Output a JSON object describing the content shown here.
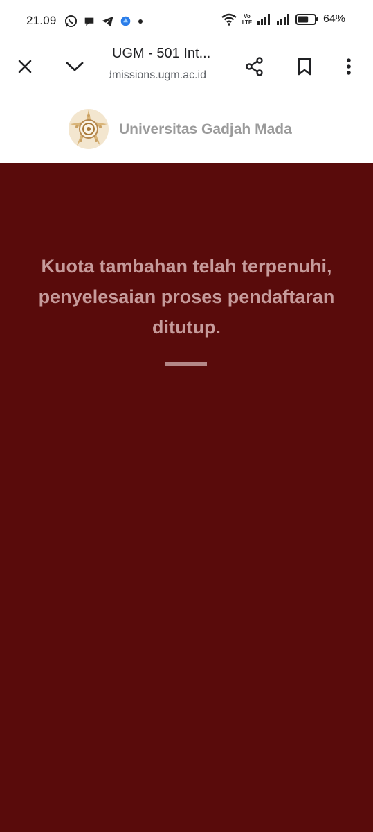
{
  "status_bar": {
    "time": "21.09",
    "notifications": [
      "whatsapp-icon",
      "chat-bubble-icon",
      "telegram-icon",
      "app-icon",
      "dot-icon"
    ],
    "network_label": "Vo LTE",
    "battery_percent": "64%",
    "battery_level": 0.64
  },
  "browser": {
    "tab_title": "UGM - 501 Int...",
    "url": "admissions.ugm.ac.id",
    "actions": [
      "close-icon",
      "chevron-down-icon",
      "share-icon",
      "bookmark-icon",
      "more-vert-icon"
    ]
  },
  "site": {
    "brand_name": "Universitas Gadjah Mada",
    "logo": "ugm-logo"
  },
  "main": {
    "message": "Kuota tambahan telah terpenuhi, penyelesaian proses pendaftaran ditutup."
  },
  "colors": {
    "background": "#590b0b",
    "message_text": "#c69b9b",
    "brand_text": "#9b9b9b"
  }
}
